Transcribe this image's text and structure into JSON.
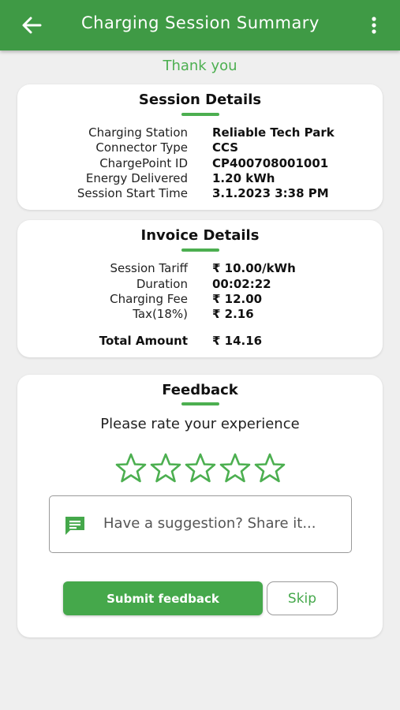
{
  "appbar": {
    "title": "Charging Session Summary",
    "back_icon": "arrow-left-icon",
    "menu_icon": "more-vertical-icon",
    "color": "#3f9a45"
  },
  "thank_you": "Thank you",
  "session_details": {
    "title": "Session Details",
    "rows": [
      {
        "label": "Charging Station",
        "value": "Reliable Tech Park"
      },
      {
        "label": "Connector Type",
        "value": "CCS"
      },
      {
        "label": "ChargePoint ID",
        "value": "CP400708001001"
      },
      {
        "label": "Energy Delivered",
        "value": "1.20 kWh"
      },
      {
        "label": "Session Start Time",
        "value": "3.1.2023 3:38 PM"
      }
    ]
  },
  "invoice_details": {
    "title": "Invoice Details",
    "rows": [
      {
        "label": "Session Tariff",
        "value": "₹ 10.00/kWh"
      },
      {
        "label": "Duration",
        "value": "00:02:22"
      },
      {
        "label": "Charging Fee",
        "value": "₹ 12.00"
      },
      {
        "label": "Tax(18%)",
        "value": "₹ 2.16"
      }
    ],
    "total": {
      "label": "Total Amount",
      "value": "₹ 14.16"
    }
  },
  "feedback": {
    "title": "Feedback",
    "prompt": "Please rate your experience",
    "rating": {
      "value": 0,
      "max": 5,
      "icon": "star-outline-icon"
    },
    "suggestion": {
      "placeholder": "Have a suggestion? Share it...",
      "icon": "chat-icon"
    },
    "submit_label": "Submit feedback",
    "skip_label": "Skip",
    "accent_color": "#4caf50"
  }
}
